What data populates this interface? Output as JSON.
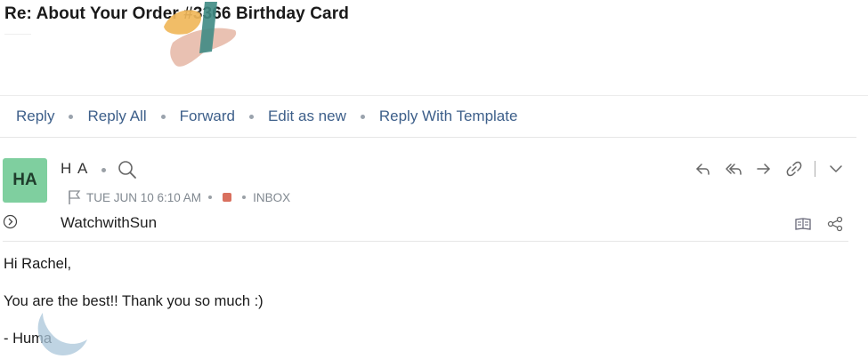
{
  "email": {
    "subject": "Re: About Your Order #3366 Birthday Card",
    "actions": [
      "Reply",
      "Reply All",
      "Forward",
      "Edit as new",
      "Reply With Template"
    ],
    "sender": {
      "initials": "HA",
      "name": "H A",
      "avatar_color": "#7fcf9f"
    },
    "meta": {
      "datetime": "TUE JUN 10 6:10 AM",
      "tag_color": "#d9705e",
      "folder": "INBOX"
    },
    "recipient": "WatchwithSun",
    "body": {
      "greeting": "Hi Rachel,",
      "message": "You are the best!! Thank you so much :)",
      "signature": "- Huma"
    },
    "toolbar_icons": [
      "reply-icon",
      "reply-all-icon",
      "forward-icon",
      "link-icon",
      "chevron-down-icon"
    ],
    "side_icons": [
      "book-icon",
      "share-icon"
    ]
  },
  "colors": {
    "link": "#3d5f8a",
    "accent_tag": "#d9705e"
  }
}
